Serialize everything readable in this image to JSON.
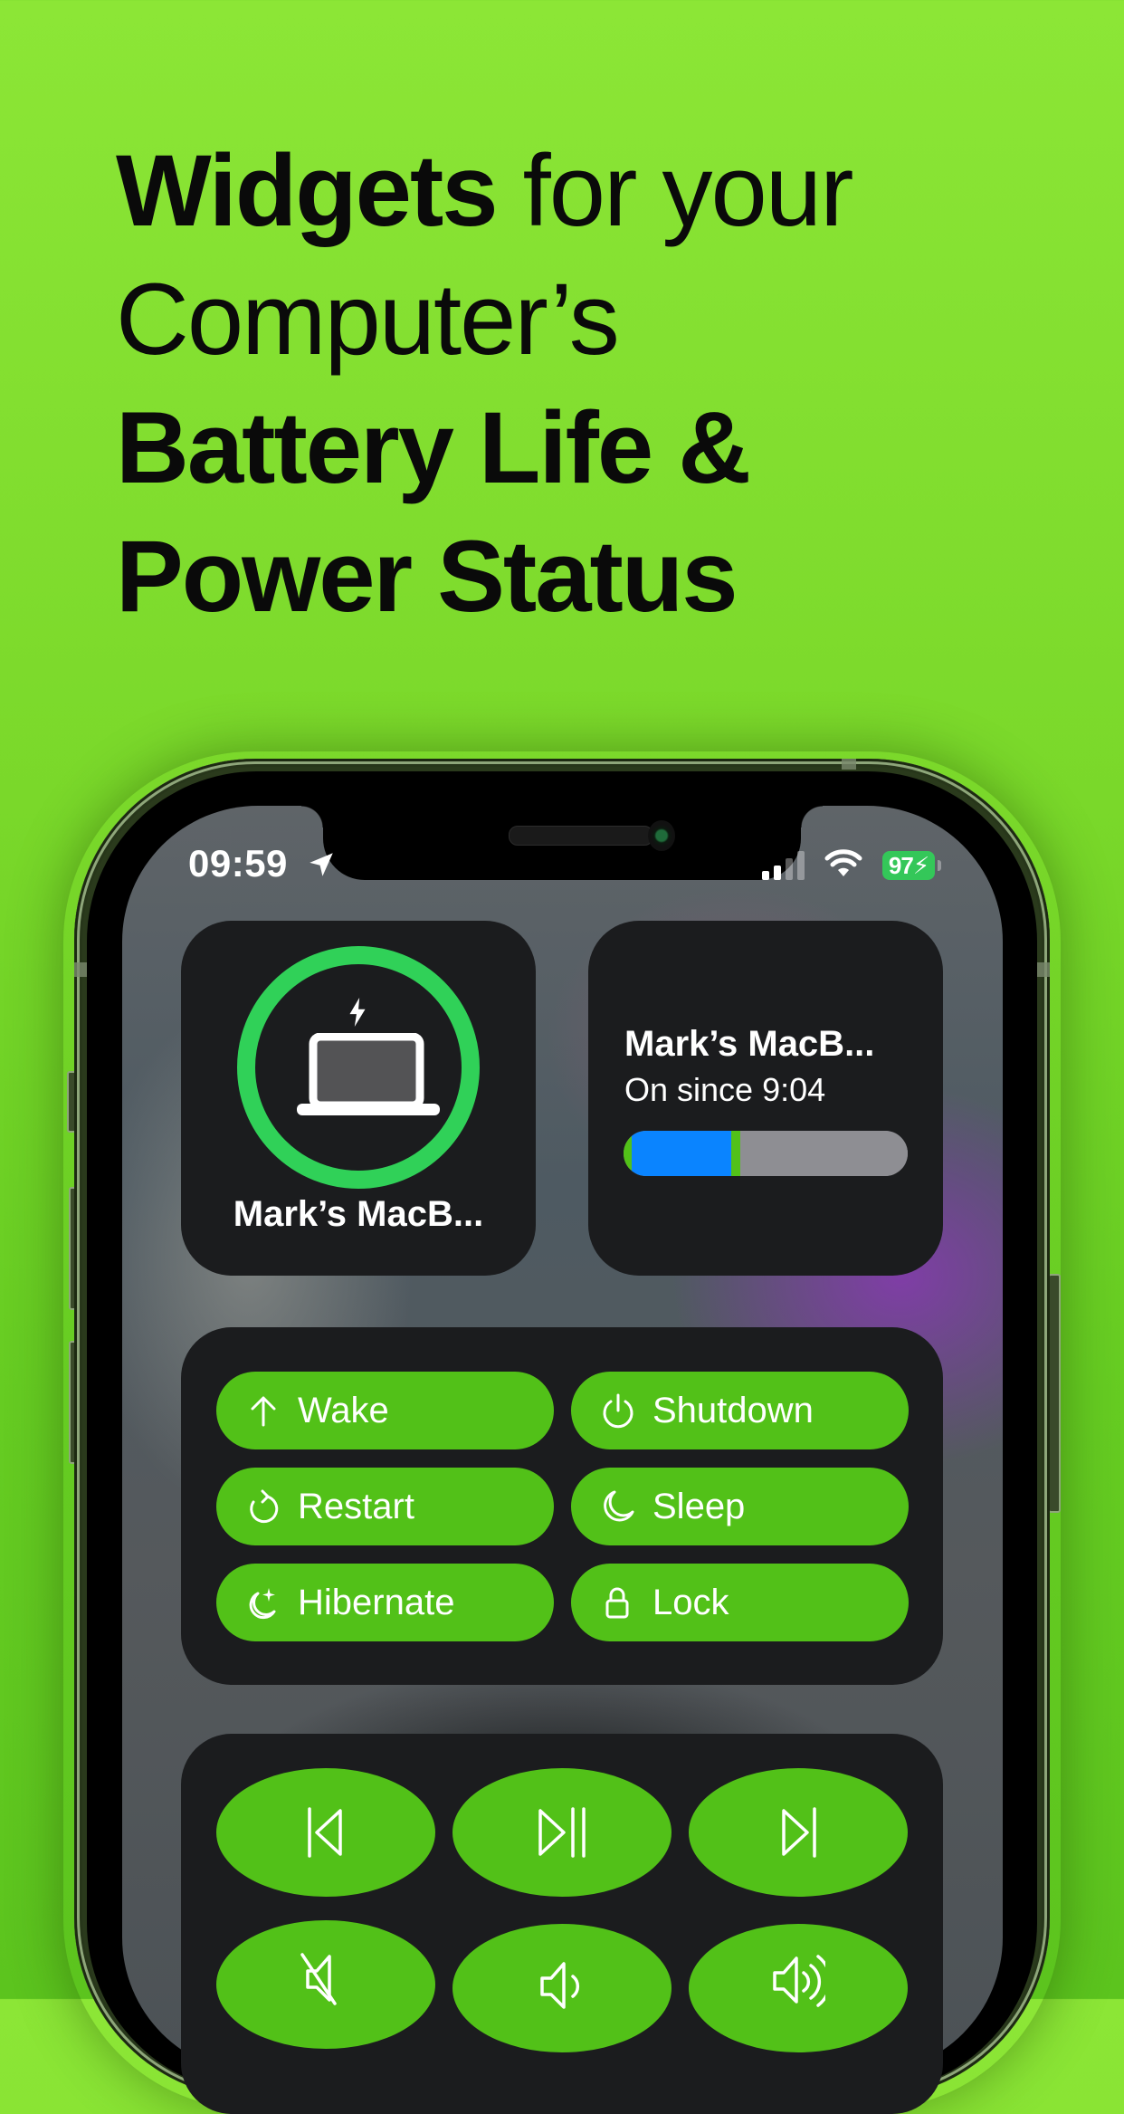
{
  "headline": {
    "line1_bold": "Widgets",
    "line1_light": " for your",
    "line2_light": "Computer’s",
    "line3_bold": "Battery Life &",
    "line4_bold": "Power Status"
  },
  "status_bar": {
    "time": "09:59",
    "location_icon": "location-arrow-icon",
    "signal_icon": "cellular-signal-icon",
    "signal_bars_active": 2,
    "signal_bars_total": 4,
    "wifi_icon": "wifi-icon",
    "battery_percent": "97",
    "battery_charging": true
  },
  "colors": {
    "background_green": "#7ad82a",
    "button_green": "#52c118",
    "ring_green": "#30d158",
    "widget_bg": "#1b1c1e",
    "timeline_blue": "#0a84ff",
    "timeline_gray": "#8e8e93"
  },
  "battery_widget": {
    "device_name": "Mark’s MacB...",
    "charge_percent": 100,
    "charging": true,
    "icon": "laptop-icon"
  },
  "uptime_widget": {
    "device_name": "Mark’s MacB...",
    "status": "On since 9:04",
    "timeline_segments": [
      {
        "state": "charging",
        "color": "#52c118",
        "from": 0.0,
        "to": 0.03
      },
      {
        "state": "on",
        "color": "#0a84ff",
        "from": 0.03,
        "to": 0.38
      },
      {
        "state": "charging",
        "color": "#52c118",
        "from": 0.38,
        "to": 0.41
      },
      {
        "state": "idle",
        "color": "#8e8e93",
        "from": 0.41,
        "to": 1.0
      }
    ]
  },
  "actions_widget": {
    "buttons": [
      {
        "label": "Wake",
        "icon": "arrow-up-icon"
      },
      {
        "label": "Shutdown",
        "icon": "power-icon"
      },
      {
        "label": "Restart",
        "icon": "restart-arrow-icon"
      },
      {
        "label": "Sleep",
        "icon": "moon-icon"
      },
      {
        "label": "Hibernate",
        "icon": "moon-stars-icon"
      },
      {
        "label": "Lock",
        "icon": "lock-icon"
      }
    ]
  },
  "media_widget": {
    "buttons": [
      {
        "name": "previous-track",
        "icon": "backward-end-icon"
      },
      {
        "name": "play-pause",
        "icon": "play-pause-icon"
      },
      {
        "name": "next-track",
        "icon": "forward-end-icon"
      },
      {
        "name": "mute",
        "icon": "speaker-slash-icon"
      },
      {
        "name": "volume-down",
        "icon": "speaker-low-icon"
      },
      {
        "name": "volume-up",
        "icon": "speaker-high-icon"
      }
    ]
  }
}
